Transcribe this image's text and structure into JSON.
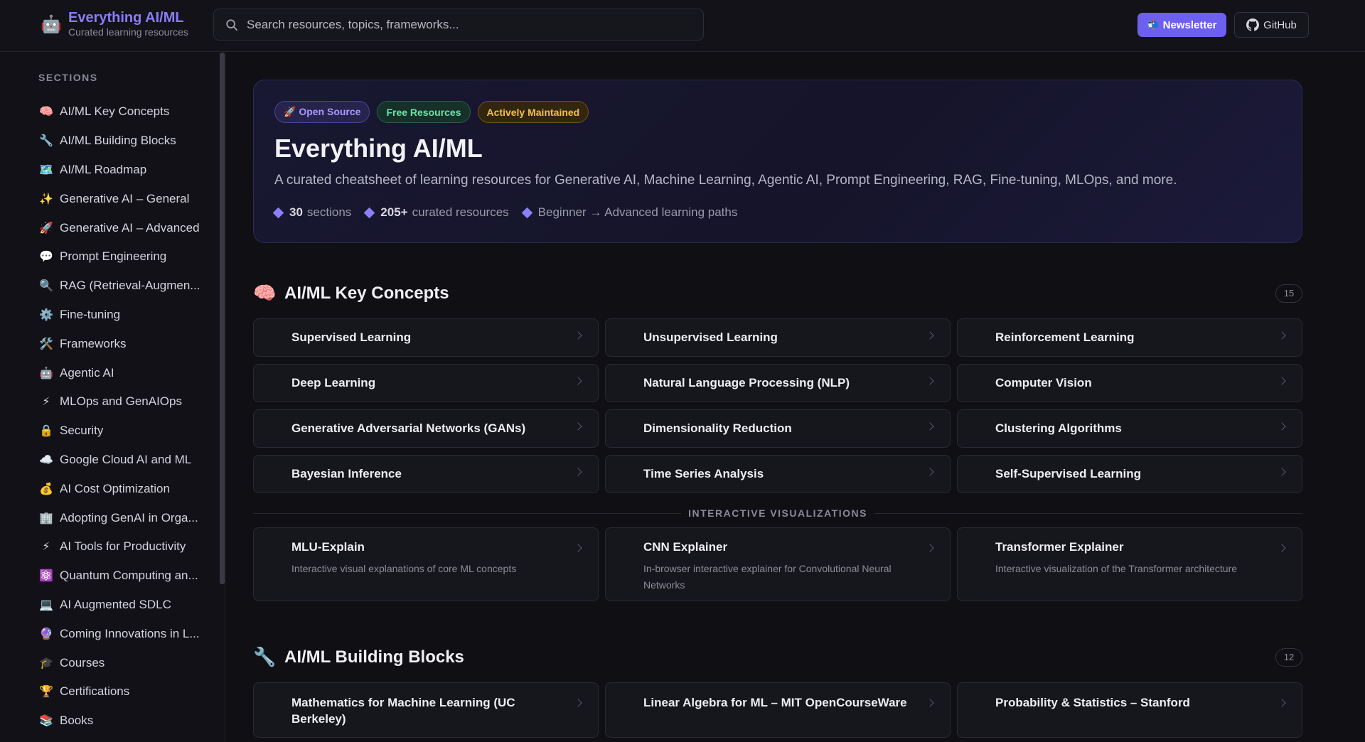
{
  "header": {
    "brand_title": "Everything AI/ML",
    "brand_subtitle": "Curated learning resources",
    "brand_icon": "robot-icon",
    "search_placeholder": "Search resources, topics, frameworks...",
    "newsletter_label": "Newsletter",
    "github_label": "GitHub",
    "accent": "#6d5ff0"
  },
  "sidebar": {
    "heading": "SECTIONS",
    "items": [
      {
        "icon": "🧠",
        "label": "AI/ML Key Concepts"
      },
      {
        "icon": "🔧",
        "label": "AI/ML Building Blocks"
      },
      {
        "icon": "🗺️",
        "label": "AI/ML Roadmap"
      },
      {
        "icon": "✨",
        "label": "Generative AI – General"
      },
      {
        "icon": "🚀",
        "label": "Generative AI – Advanced"
      },
      {
        "icon": "💬",
        "label": "Prompt Engineering"
      },
      {
        "icon": "🔍",
        "label": "RAG (Retrieval-Augmen..."
      },
      {
        "icon": "⚙️",
        "label": "Fine-tuning"
      },
      {
        "icon": "🛠️",
        "label": "Frameworks"
      },
      {
        "icon": "🤖",
        "label": "Agentic AI"
      },
      {
        "icon": "⚡",
        "label": "MLOps and GenAIOps"
      },
      {
        "icon": "🔒",
        "label": "Security"
      },
      {
        "icon": "☁️",
        "label": "Google Cloud AI and ML"
      },
      {
        "icon": "💰",
        "label": "AI Cost Optimization"
      },
      {
        "icon": "🏢",
        "label": "Adopting GenAI in Orga..."
      },
      {
        "icon": "⚡",
        "label": "AI Tools for Productivity"
      },
      {
        "icon": "⚛️",
        "label": "Quantum Computing an..."
      },
      {
        "icon": "💻",
        "label": "AI Augmented SDLC"
      },
      {
        "icon": "🔮",
        "label": "Coming Innovations in L..."
      },
      {
        "icon": "🎓",
        "label": "Courses"
      },
      {
        "icon": "🏆",
        "label": "Certifications"
      },
      {
        "icon": "📚",
        "label": "Books"
      }
    ]
  },
  "hero": {
    "badges": [
      "🚀 Open Source",
      "Free Resources",
      "Actively Maintained"
    ],
    "title": "Everything AI/ML",
    "description": "A curated cheatsheet of learning resources for Generative AI, Machine Learning, Agentic AI, Prompt Engineering, RAG, Fine-tuning, MLOps, and more.",
    "stats": [
      {
        "value": "30",
        "label": "sections"
      },
      {
        "value": "205+",
        "label": "curated resources"
      },
      {
        "value": "",
        "label": "Beginner → Advanced learning paths"
      }
    ]
  },
  "sections": [
    {
      "icon": "🧠",
      "title": "AI/ML Key Concepts",
      "count": "15",
      "cards": [
        "Supervised Learning",
        "Unsupervised Learning",
        "Reinforcement Learning",
        "Deep Learning",
        "Natural Language Processing (NLP)",
        "Computer Vision",
        "Generative Adversarial Networks (GANs)",
        "Dimensionality Reduction",
        "Clustering Algorithms",
        "Bayesian Inference",
        "Time Series Analysis",
        "Self-Supervised Learning"
      ],
      "subsection": {
        "label": "INTERACTIVE VISUALIZATIONS",
        "cards": [
          {
            "title": "MLU-Explain",
            "desc": "Interactive visual explanations of core ML concepts"
          },
          {
            "title": "CNN Explainer",
            "desc": "In-browser interactive explainer for Convolutional Neural Networks"
          },
          {
            "title": "Transformer Explainer",
            "desc": "Interactive visualization of the Transformer architecture"
          }
        ]
      }
    },
    {
      "icon": "🔧",
      "title": "AI/ML Building Blocks",
      "count": "12",
      "cards": [
        "Mathematics for Machine Learning (UC Berkeley)",
        "Linear Algebra for ML – MIT OpenCourseWare",
        "Probability & Statistics – Stanford"
      ]
    }
  ]
}
